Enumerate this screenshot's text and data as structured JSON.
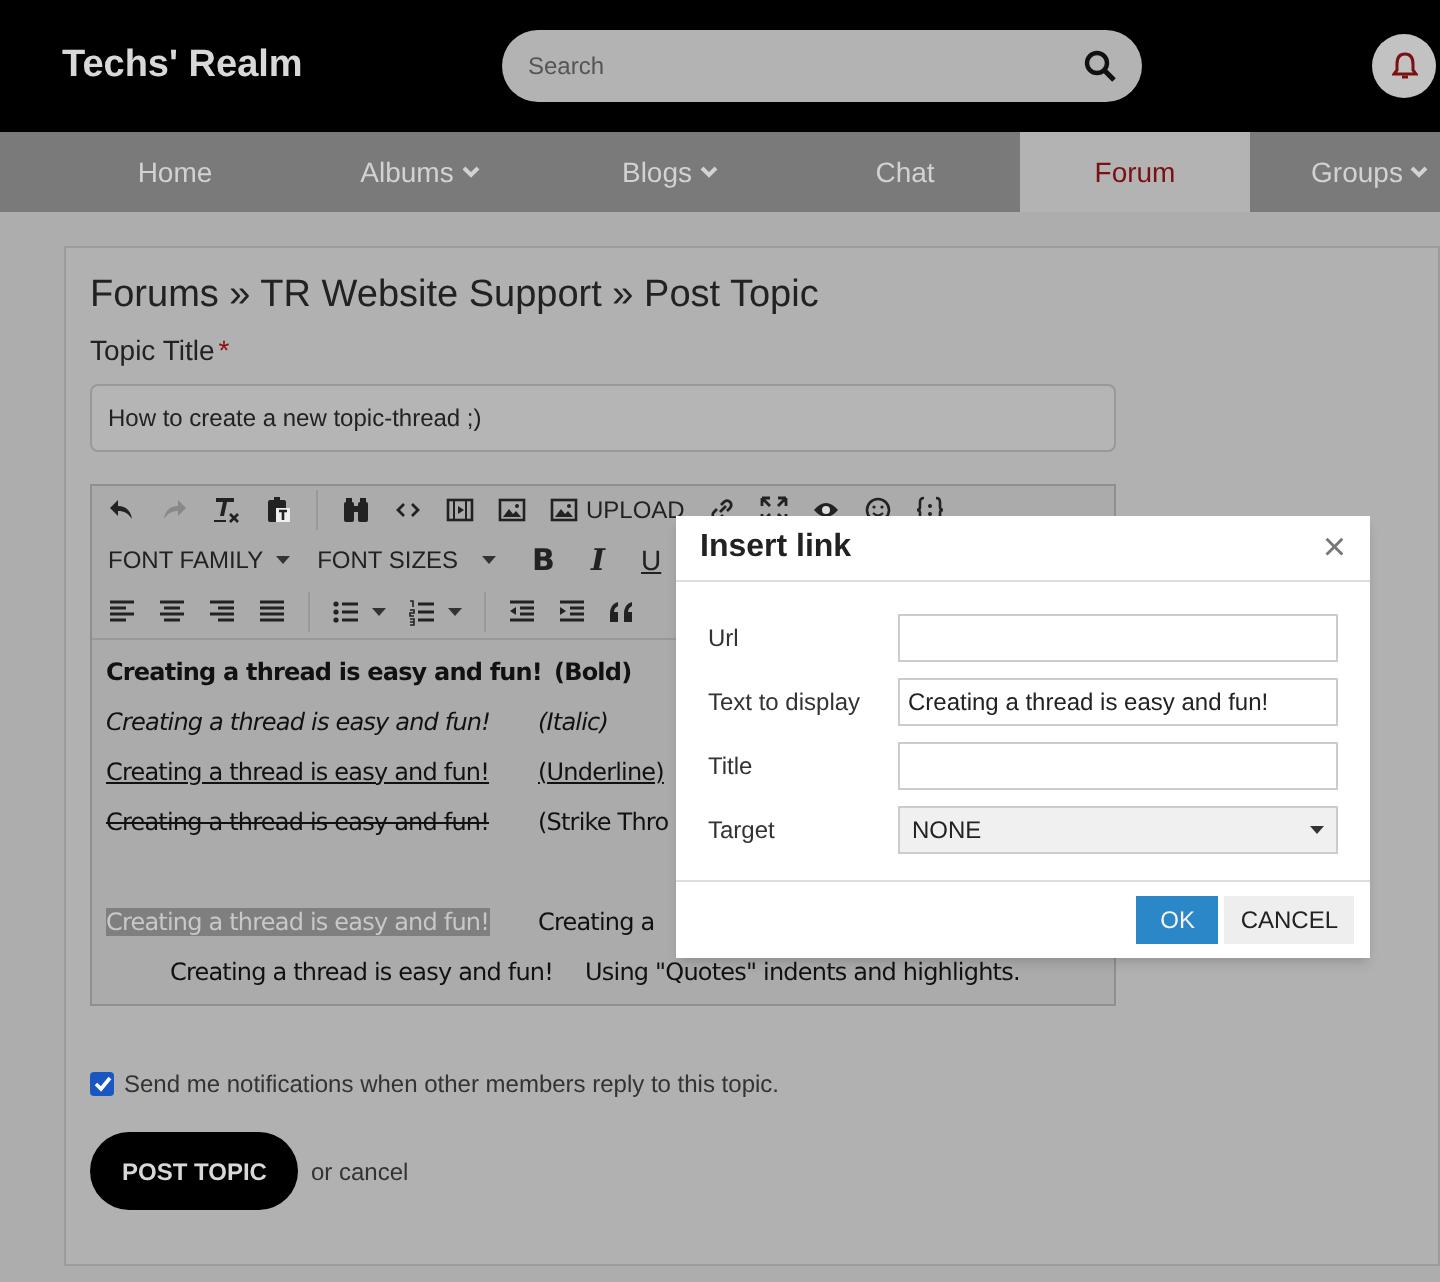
{
  "header": {
    "logo": "Techs' Realm",
    "search": {
      "placeholder": "Search"
    }
  },
  "nav": [
    {
      "label": "Home",
      "dropdown": false,
      "selected": false
    },
    {
      "label": "Albums",
      "dropdown": true,
      "selected": false
    },
    {
      "label": "Blogs",
      "dropdown": true,
      "selected": false
    },
    {
      "label": "Chat",
      "dropdown": false,
      "selected": false
    },
    {
      "label": "Forum",
      "dropdown": false,
      "selected": true
    },
    {
      "label": "Groups",
      "dropdown": true,
      "selected": false
    }
  ],
  "page_title": "Forums » TR Website Support » Post Topic",
  "topic": {
    "label": "Topic Title",
    "required_mark": "*",
    "value": "How to create a new topic-thread ;)"
  },
  "toolbar": {
    "upload": "UPLOAD",
    "font_family": "FONT FAMILY",
    "font_sizes": "FONT SIZES",
    "bold": "B",
    "italic": "I",
    "underline": "U"
  },
  "editor_lines": [
    {
      "kind": "bold",
      "text": "Creating a thread is easy and fun!",
      "note": "(Bold)"
    },
    {
      "kind": "italic",
      "text": "Creating a thread is easy and fun!",
      "note": "(Italic)"
    },
    {
      "kind": "underline",
      "text": "Creating a thread is easy and fun!",
      "note": "(Underline)"
    },
    {
      "kind": "strike",
      "text": "Creating a thread is easy and fun!",
      "note": "(Strike Thro"
    },
    {
      "kind": "blank"
    },
    {
      "kind": "highlight",
      "text": "Creating a thread is easy and fun!",
      "note": "Creating a"
    },
    {
      "kind": "quote",
      "text": "Creating a thread is easy and fun!",
      "note": "Using \"Quotes\" indents and highlights."
    }
  ],
  "notify": {
    "label": "Send me notifications when other members reply to this topic.",
    "checked": true
  },
  "submit": {
    "label": "POST TOPIC",
    "cancel": "or cancel"
  },
  "dialog": {
    "title": "Insert link",
    "close": "×",
    "fields": [
      {
        "kind": "text",
        "label": "Url"
      },
      {
        "kind": "text",
        "label": "Text to display",
        "value": "Creating a thread is easy and fun!"
      },
      {
        "kind": "text",
        "label": "Title"
      },
      {
        "kind": "select",
        "label": "Target",
        "value": "NONE"
      }
    ],
    "buttons": [
      {
        "label": "OK",
        "primary": true
      },
      {
        "label": "CANCEL",
        "primary": false
      }
    ]
  }
}
